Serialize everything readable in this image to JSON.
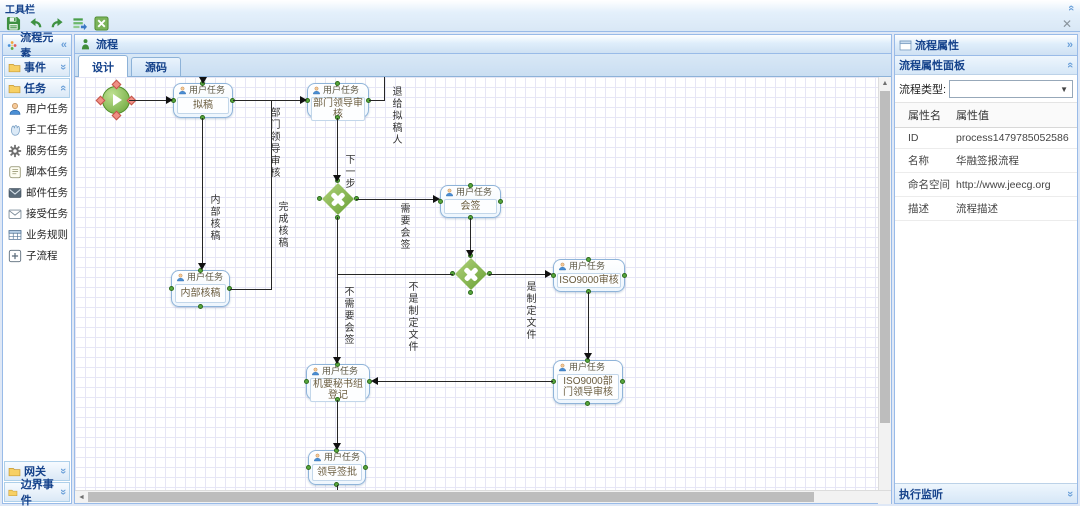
{
  "ui": {
    "glyph_dbl_left": "«",
    "glyph_dbl_right": "»",
    "glyph_close": "✕",
    "glyph_dropdown": "▼",
    "glyph_up_small": "▲",
    "glyph_left_small": "◄"
  },
  "toolbar": {
    "title": "工具栏"
  },
  "palette": {
    "title": "流程元素",
    "sections": [
      {
        "label": "事件",
        "collapsed": true
      },
      {
        "label": "任务",
        "collapsed": false
      },
      {
        "label": "网关",
        "collapsed": true
      },
      {
        "label": "边界事件",
        "collapsed": true
      }
    ],
    "task_items": [
      "用户任务",
      "手工任务",
      "服务任务",
      "脚本任务",
      "邮件任务",
      "接受任务",
      "业务规则",
      "子流程"
    ]
  },
  "designer": {
    "title": "流程",
    "tabs": [
      {
        "label": "设计",
        "active": true
      },
      {
        "label": "源码",
        "active": false
      }
    ]
  },
  "canvas": {
    "nodes": [
      {
        "type": "用户任务",
        "name": "拟稿"
      },
      {
        "type": "用户任务",
        "name": "部门领导审核"
      },
      {
        "type": "用户任务",
        "name": "会签"
      },
      {
        "type": "用户任务",
        "name": "ISO9000审核"
      },
      {
        "type": "用户任务",
        "name": "内部核稿"
      },
      {
        "type": "用户任务",
        "name": "机要秘书组登记"
      },
      {
        "type": "用户任务",
        "name": "ISO9000部门领导审核"
      },
      {
        "type": "用户任务",
        "name": "领导签批"
      }
    ],
    "edge_labels": [
      "部门领导审核",
      "退给拟稿人",
      "下一步",
      "需要会签",
      "内部核稿",
      "完成核稿",
      "不需要会签",
      "不是制定文件",
      "是制定文件"
    ]
  },
  "properties": {
    "panel_title": "流程属性",
    "board_title": "流程属性面板",
    "type_label": "流程类型:",
    "type_value": "",
    "table": {
      "headers": [
        "属性名",
        "属性值"
      ],
      "rows": [
        [
          "ID",
          "process1479785052586"
        ],
        [
          "名称",
          "华融签报流程"
        ],
        [
          "命名空间",
          "http://www.jeecg.org"
        ],
        [
          "描述",
          "流程描述"
        ]
      ]
    },
    "listener_title": "执行监听"
  },
  "colors": {
    "accent_text": "#15428b",
    "panel_border": "#99bbe8",
    "gateway_green": "#679f33",
    "node_border": "#8fb4d9",
    "start_green": "#68a437",
    "handle_red": "#f08f85",
    "grid_line": "#e6e6f5"
  }
}
